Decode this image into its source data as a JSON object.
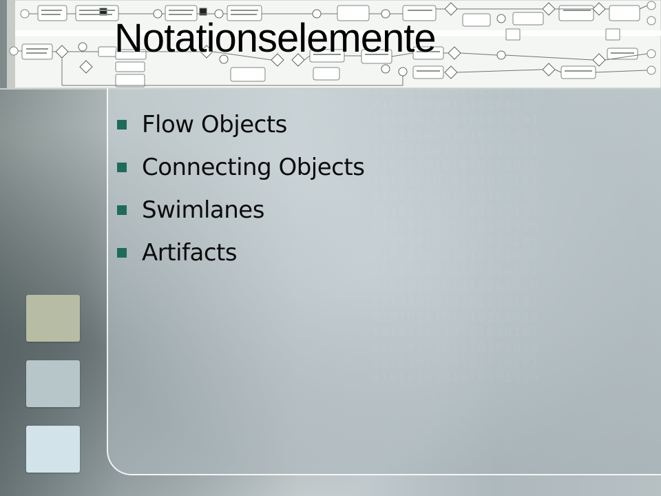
{
  "slide": {
    "title": "Notationselemente",
    "bullets": [
      "Flow Objects",
      "Connecting Objects",
      "Swimlanes",
      "Artifacts"
    ]
  },
  "colors": {
    "bullet": "#1f6b5a",
    "swatch_1": "#b7bca4",
    "swatch_2": "#b7c6c9",
    "swatch_3": "#d2e4ea"
  },
  "decor": {
    "banner_image": "bpmn-process-diagram",
    "background": "blurred-binary-digits"
  }
}
